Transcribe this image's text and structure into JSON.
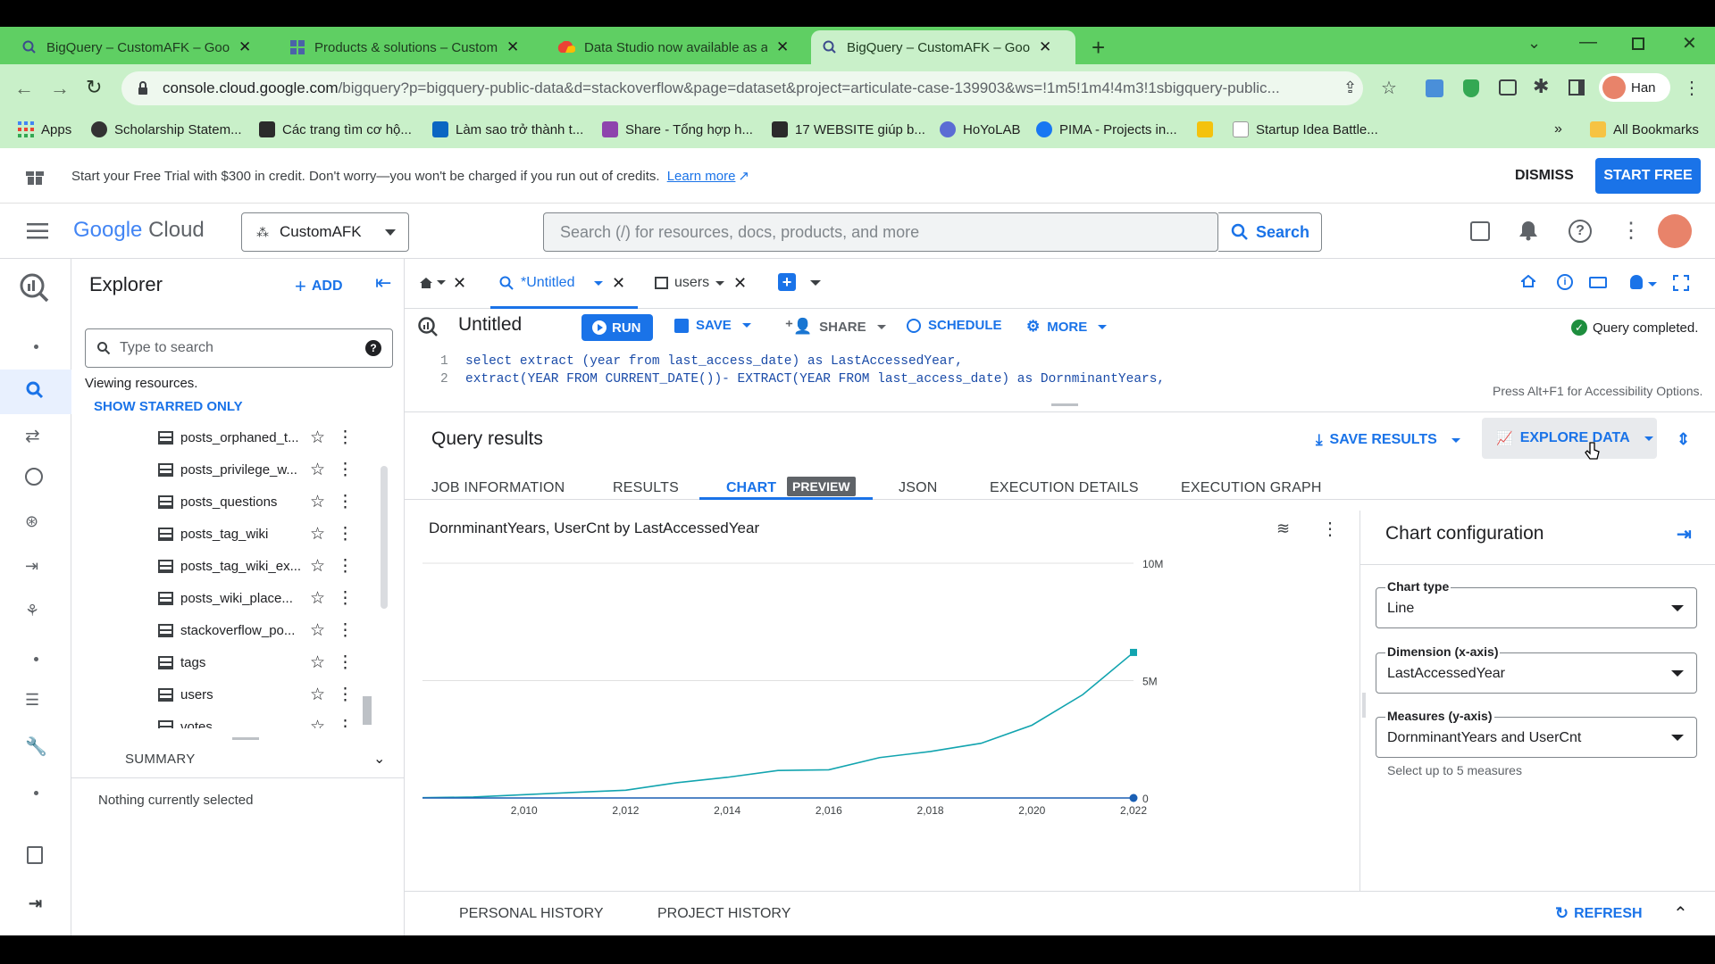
{
  "browser": {
    "tabs": [
      {
        "title": "BigQuery – CustomAFK – Googl"
      },
      {
        "title": "Products & solutions – CustomA"
      },
      {
        "title": "Data Studio now available as a G"
      },
      {
        "title": "BigQuery – CustomAFK – Googl"
      }
    ],
    "url_host": "console.cloud.google.com",
    "url_rest": "/bigquery?p=bigquery-public-data&d=stackoverflow&page=dataset&project=articulate-case-139903&ws=!1m5!1m4!4m3!1sbigquery-public...",
    "profile_name": "Han",
    "bookmarks": [
      "Apps",
      "Scholarship Statem...",
      "Các trang tìm cơ hộ...",
      "Làm sao trở thành t...",
      "Share - Tổng hợp h...",
      "17 WEBSITE giúp b...",
      "HoYoLAB",
      "PIMA - Projects in...",
      "Startup Idea Battle..."
    ],
    "all_bookmarks": "All Bookmarks"
  },
  "trial_banner": {
    "text": "Start your Free Trial with $300 in credit. Don't worry—you won't be charged if you run out of credits.",
    "link": "Learn more",
    "dismiss": "DISMISS",
    "start": "START FREE"
  },
  "header": {
    "logo_google": "Google",
    "logo_cloud": "Cloud",
    "project": "CustomAFK",
    "search_placeholder": "Search (/) for resources, docs, products, and more",
    "search_button": "Search"
  },
  "explorer": {
    "title": "Explorer",
    "add": "ADD",
    "search_placeholder": "Type to search",
    "viewing": "Viewing resources.",
    "show_starred": "SHOW STARRED ONLY",
    "tables": [
      "posts_orphaned_t...",
      "posts_privilege_w...",
      "posts_questions",
      "posts_tag_wiki",
      "posts_tag_wiki_ex...",
      "posts_wiki_place...",
      "stackoverflow_po...",
      "tags",
      "users",
      "votes"
    ],
    "summary": "SUMMARY",
    "nothing_selected": "Nothing currently selected"
  },
  "editor": {
    "tabs": {
      "untitled": "*Untitled",
      "users": "users"
    },
    "title": "Untitled",
    "run": "RUN",
    "save": "SAVE",
    "share": "SHARE",
    "schedule": "SCHEDULE",
    "more": "MORE",
    "status": "Query completed.",
    "lines": [
      {
        "num": "1",
        "text": "select extract (year from last_access_date) as LastAccessedYear,"
      },
      {
        "num": "2",
        "text": "extract(YEAR FROM CURRENT_DATE())- EXTRACT(YEAR FROM last_access_date) as DornminantYears,"
      }
    ],
    "accessibility_hint": "Press Alt+F1 for Accessibility Options."
  },
  "results": {
    "title": "Query results",
    "save_results": "SAVE RESULTS",
    "explore_data": "EXPLORE DATA",
    "tabs": [
      "JOB INFORMATION",
      "RESULTS",
      "CHART",
      "JSON",
      "EXECUTION DETAILS",
      "EXECUTION GRAPH"
    ],
    "preview_badge": "PREVIEW",
    "active_tab": "CHART"
  },
  "chart_config": {
    "title": "Chart configuration",
    "chart_type_label": "Chart type",
    "chart_type": "Line",
    "dimension_label": "Dimension (x-axis)",
    "dimension": "LastAccessedYear",
    "measures_label": "Measures (y-axis)",
    "measures": "DornminantYears and UserCnt",
    "measures_hint": "Select up to 5 measures"
  },
  "history": {
    "personal": "PERSONAL HISTORY",
    "project": "PROJECT HISTORY",
    "refresh": "REFRESH"
  },
  "chart_data": {
    "type": "line",
    "title": "DornminantYears, UserCnt by LastAccessedYear",
    "x_ticks": [
      "2,010",
      "2,012",
      "2,014",
      "2,016",
      "2,018",
      "2,020",
      "2,022"
    ],
    "y_ticks": [
      "0",
      "5M",
      "10M"
    ],
    "xlim": [
      2008,
      2022
    ],
    "ylim": [
      0,
      10000000
    ],
    "series": [
      {
        "color": "#12a4af",
        "x": [
          2008,
          2009,
          2010,
          2011,
          2012,
          2013,
          2014,
          2015,
          2016,
          2017,
          2018,
          2019,
          2020,
          2021,
          2022
        ],
        "values": [
          10000,
          40000,
          140000,
          240000,
          330000,
          650000,
          880000,
          1170000,
          1200000,
          1720000,
          1980000,
          2330000,
          3100000,
          4400000,
          6200000
        ]
      },
      {
        "color": "#1a5fb4",
        "x": [
          2008,
          2009,
          2010,
          2011,
          2012,
          2013,
          2014,
          2015,
          2016,
          2017,
          2018,
          2019,
          2020,
          2021,
          2022
        ],
        "values": [
          14,
          13,
          12,
          11,
          10,
          9,
          8,
          7,
          6,
          5,
          4,
          3,
          2,
          1,
          0
        ]
      }
    ]
  }
}
